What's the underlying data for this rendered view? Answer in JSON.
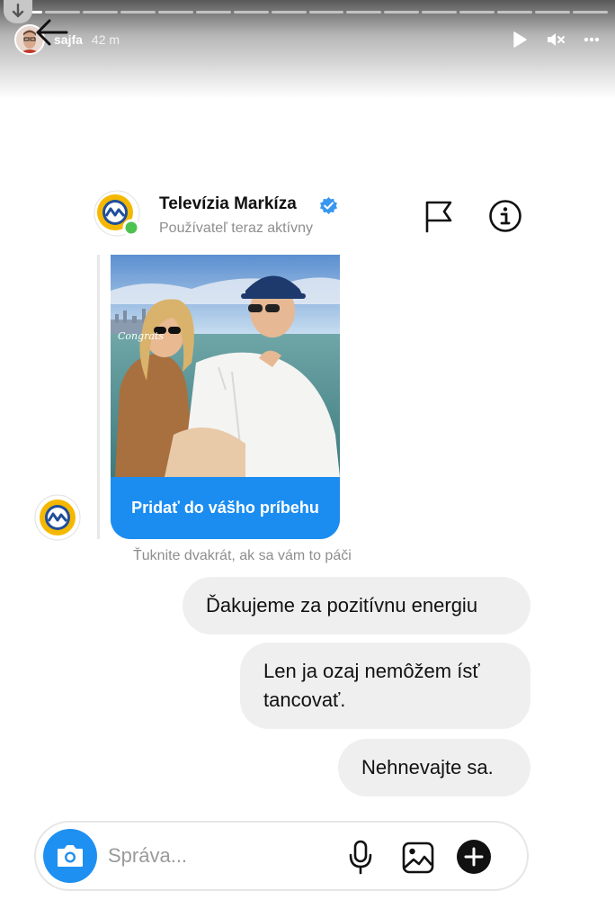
{
  "story": {
    "username": "sajfa",
    "time": "42 m",
    "progress_segments": 16,
    "progress_done": 1
  },
  "dm": {
    "contact_name": "Televízia Markíza",
    "status": "Používateľ teraz aktívny",
    "verified": true
  },
  "shared_story": {
    "photo_caption": "Congrats",
    "button_label": "Pridať do vášho príbehu"
  },
  "hint": "Ťuknite dvakrát, ak sa vám to páči",
  "messages": [
    {
      "text": "Ďakujeme za pozitívnu energiu"
    },
    {
      "text": "Len ja ozaj nemôžem ísť tancovať."
    },
    {
      "text": "Nehnevajte sa."
    }
  ],
  "composer": {
    "placeholder": "Správa..."
  },
  "colors": {
    "accent": "#1b8df0",
    "online": "#4cc24f",
    "verified": "#3897f0"
  },
  "icons": [
    "download-icon",
    "play-icon",
    "mute-icon",
    "more-icon",
    "back-arrow-icon",
    "verified-icon",
    "flag-icon",
    "info-icon",
    "camera-icon",
    "microphone-icon",
    "gallery-icon",
    "plus-icon"
  ]
}
